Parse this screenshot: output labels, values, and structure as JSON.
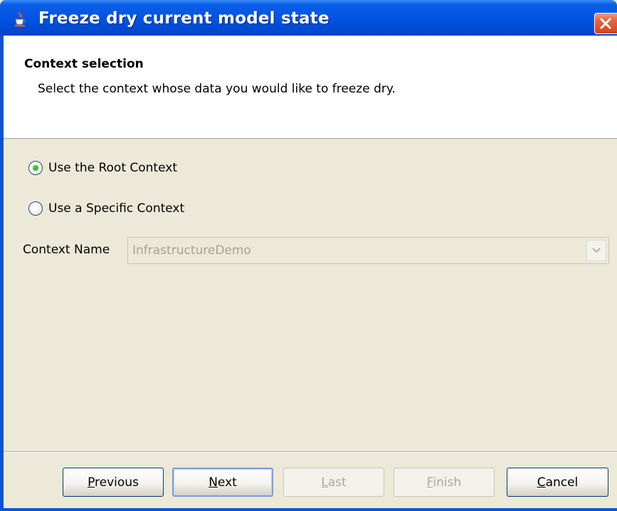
{
  "window": {
    "title": "Freeze dry current model state",
    "icon": "java-cup-icon",
    "close_icon": "close-icon"
  },
  "header": {
    "title": "Context selection",
    "description": "Select the context whose data you would like to freeze dry."
  },
  "options": {
    "root": {
      "label": "Use the Root Context",
      "checked": true
    },
    "specific": {
      "label": "Use a Specific Context",
      "checked": false
    }
  },
  "context": {
    "label": "Context Name",
    "value": "InfrastructureDemo",
    "enabled": false
  },
  "buttons": {
    "previous": {
      "mnemonic": "P",
      "rest": "revious",
      "enabled": true
    },
    "next": {
      "mnemonic": "N",
      "rest": "ext",
      "enabled": true,
      "focused": true
    },
    "last": {
      "mnemonic": "L",
      "rest": "ast",
      "enabled": false
    },
    "finish": {
      "mnemonic": "F",
      "rest": "inish",
      "enabled": false
    },
    "cancel": {
      "mnemonic": "C",
      "rest": "ancel",
      "enabled": true
    }
  },
  "colors": {
    "titlebar": "#0054e3",
    "panel": "#ece9d8",
    "radio_check": "#21a121",
    "close_button": "#d0461d"
  }
}
